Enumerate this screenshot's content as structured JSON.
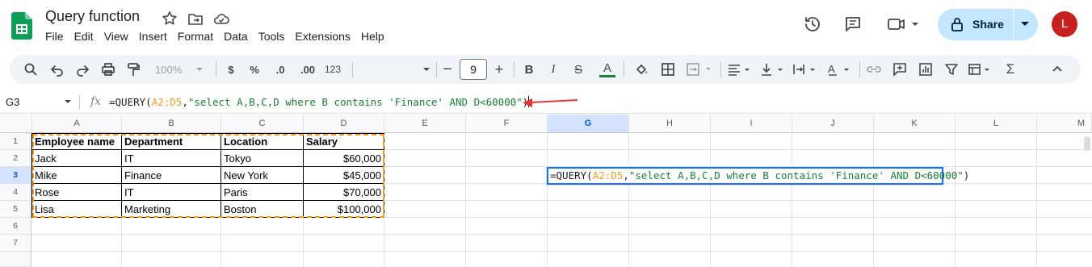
{
  "app": {
    "doc_title": "Query function",
    "menu": [
      "File",
      "Edit",
      "View",
      "Insert",
      "Format",
      "Data",
      "Tools",
      "Extensions",
      "Help"
    ],
    "share_label": "Share",
    "avatar_letter": "L",
    "icons": [
      "sheets-logo",
      "star-icon",
      "move-folder-icon",
      "cloud-saved-icon",
      "history-icon",
      "comment-icon",
      "meet-icon"
    ]
  },
  "toolbar": {
    "zoom": "100%",
    "currency": "$",
    "percent": "%",
    "dec_decrease": ".0",
    "dec_increase": ".00",
    "more_formats": "123",
    "font_size": "9"
  },
  "formula_bar": {
    "name_box": "G3",
    "fx": "fx",
    "formula_prefix": "=QUERY(",
    "formula_range": "A2:D5",
    "formula_sep": ",",
    "formula_string": "\"select A,B,C,D where B contains 'Finance' AND D<60000\"",
    "formula_suffix": ")"
  },
  "sheet": {
    "columns": [
      "A",
      "B",
      "C",
      "D",
      "E",
      "F",
      "G",
      "H",
      "I",
      "J",
      "K",
      "L",
      "M"
    ],
    "active_column": "G",
    "rows": [
      "1",
      "2",
      "3",
      "4",
      "5",
      "6",
      "7"
    ],
    "active_row": "3",
    "headers": [
      "Employee name",
      "Department",
      "Location",
      "Salary"
    ],
    "data": [
      [
        "Jack",
        "IT",
        "Tokyo",
        "$60,000"
      ],
      [
        "Mike",
        "Finance",
        "New York",
        "$45,000"
      ],
      [
        "Rose",
        "IT",
        "Paris",
        "$70,000"
      ],
      [
        "Lisa",
        "Marketing",
        "Boston",
        "$100,000"
      ]
    ]
  },
  "colors": {
    "accent": "#1a73e8",
    "share_bg": "#c2e7ff",
    "avatar_bg": "#c5221f",
    "range_ref": "#f7981d",
    "string_lit": "#188038",
    "annotation_arrow": "#e53935"
  }
}
